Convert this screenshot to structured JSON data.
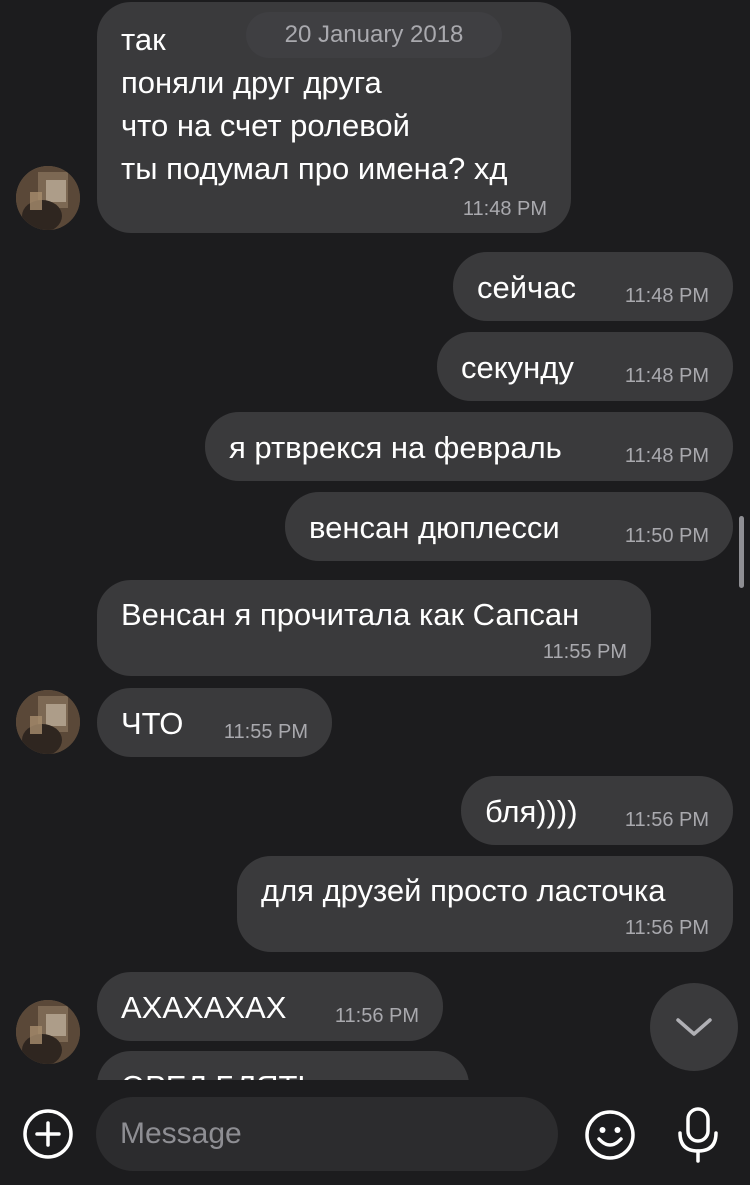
{
  "date_divider": "20 January 2018",
  "messages": [
    {
      "side": "incoming",
      "text": "так\nпоняли друг друга\nчто на счет ролевой\nты подумал про имена? хд",
      "time": "11:48 PM"
    },
    {
      "side": "outgoing",
      "text": "сейчас",
      "time": "11:48 PM"
    },
    {
      "side": "outgoing",
      "text": "секунду",
      "time": "11:48 PM"
    },
    {
      "side": "outgoing",
      "text": "я ртврекся на февраль",
      "time": "11:48 PM"
    },
    {
      "side": "outgoing",
      "text": "венсан дюплесси",
      "time": "11:50 PM"
    },
    {
      "side": "incoming",
      "text": "Венсан я прочитала как Сапсан",
      "time": "11:55 PM"
    },
    {
      "side": "incoming",
      "text": "ЧТО",
      "time": "11:55 PM"
    },
    {
      "side": "outgoing",
      "text": "бля))))",
      "time": "11:56 PM"
    },
    {
      "side": "outgoing",
      "text": "для друзей просто ласточка",
      "time": "11:56 PM"
    },
    {
      "side": "incoming",
      "text": "АХАХАХАХ",
      "time": "11:56 PM"
    },
    {
      "side": "incoming",
      "text": "ОРЕЛ БЛЯТЬ",
      "time": ""
    }
  ],
  "composer": {
    "placeholder": "Message",
    "add_icon": "plus-circle-icon",
    "emoji_icon": "smiley-icon",
    "mic_icon": "microphone-icon"
  },
  "scroll_down_icon": "chevron-down-icon",
  "colors": {
    "background": "#1c1c1e",
    "bubble": "#3a3a3c",
    "timestamp": "#a9a9ae",
    "input_field": "#2c2c2e"
  }
}
